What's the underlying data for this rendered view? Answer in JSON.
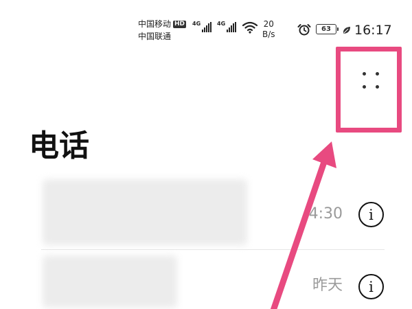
{
  "status_bar": {
    "carrier_primary": "中国移动",
    "hd_badge": "HD",
    "carrier_secondary": "中国联通",
    "network_1": "4G",
    "network_2": "4G",
    "speed_value": "20",
    "speed_unit": "B/s",
    "battery_level": "63",
    "time": "16:17",
    "icons": [
      "signal-icon",
      "signal-icon",
      "wifi-icon",
      "alarm-icon",
      "battery-icon",
      "leaf-icon"
    ]
  },
  "header": {
    "title": "电话",
    "menu_icon": "more-options-icon"
  },
  "calls": [
    {
      "time": "4:30",
      "info_icon": "info-icon",
      "info_label": "i"
    },
    {
      "time": "昨天",
      "info_icon": "info-icon",
      "info_label": "i"
    }
  ],
  "annotation": {
    "highlight_color": "#e84a80"
  }
}
